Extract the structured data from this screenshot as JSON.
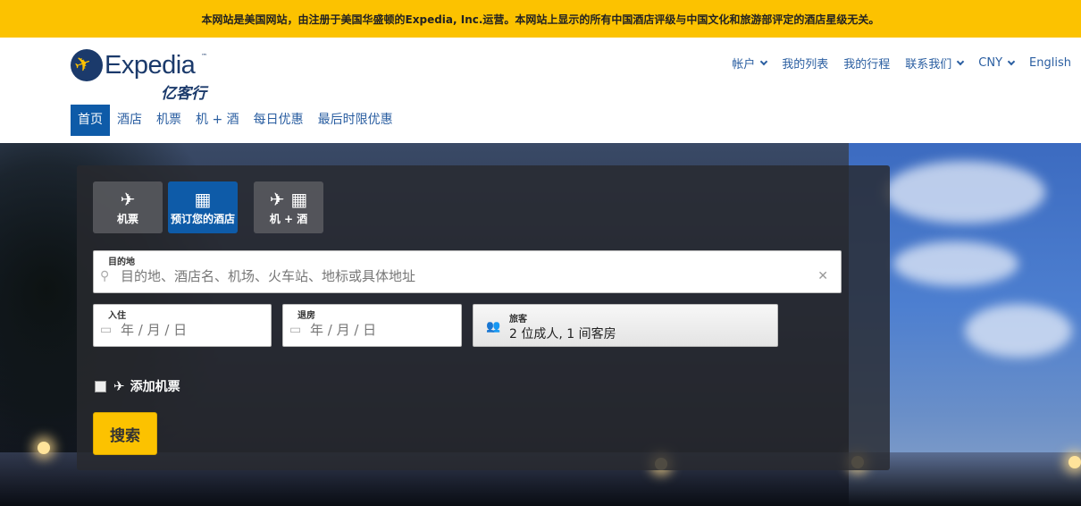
{
  "notice": "本网站是美国网站，由注册于美国华盛顿的Expedia, Inc.运营。本网站上显示的所有中国酒店评级与中国文化和旅游部评定的酒店星级无关。",
  "logo": {
    "brand": "Expedia",
    "tm": "™",
    "cn": "亿客行"
  },
  "topnav": [
    {
      "label": "帐户",
      "dropdown": true
    },
    {
      "label": "我的列表",
      "dropdown": false
    },
    {
      "label": "我的行程",
      "dropdown": false
    },
    {
      "label": "联系我们",
      "dropdown": true
    },
    {
      "label": "CNY",
      "dropdown": true
    },
    {
      "label": "English",
      "dropdown": false
    }
  ],
  "mainnav": [
    "首页",
    "酒店",
    "机票",
    "机 + 酒",
    "每日优惠",
    "最后时限优惠"
  ],
  "search": {
    "tabs": [
      {
        "label": "机票",
        "icon": "plane-icon"
      },
      {
        "label": "预订您的酒店",
        "icon": "hotel-icon"
      },
      {
        "label": "机 + 酒",
        "icon": "plane-hotel-icon"
      }
    ],
    "destination_label": "目的地",
    "destination_placeholder": "目的地、酒店名、机场、火车站、地标或具体地址",
    "checkin_label": "入住",
    "checkout_label": "退房",
    "date_placeholder": "年 / 月 / 日",
    "guests_label": "旅客",
    "guests_value": "2 位成人, 1 间客房",
    "add_flight_label": "添加机票",
    "search_button": "搜索"
  },
  "colors": {
    "accent_yellow": "#fcc200",
    "brand_blue": "#0e5ba8",
    "link_blue": "#2a5ea1"
  }
}
